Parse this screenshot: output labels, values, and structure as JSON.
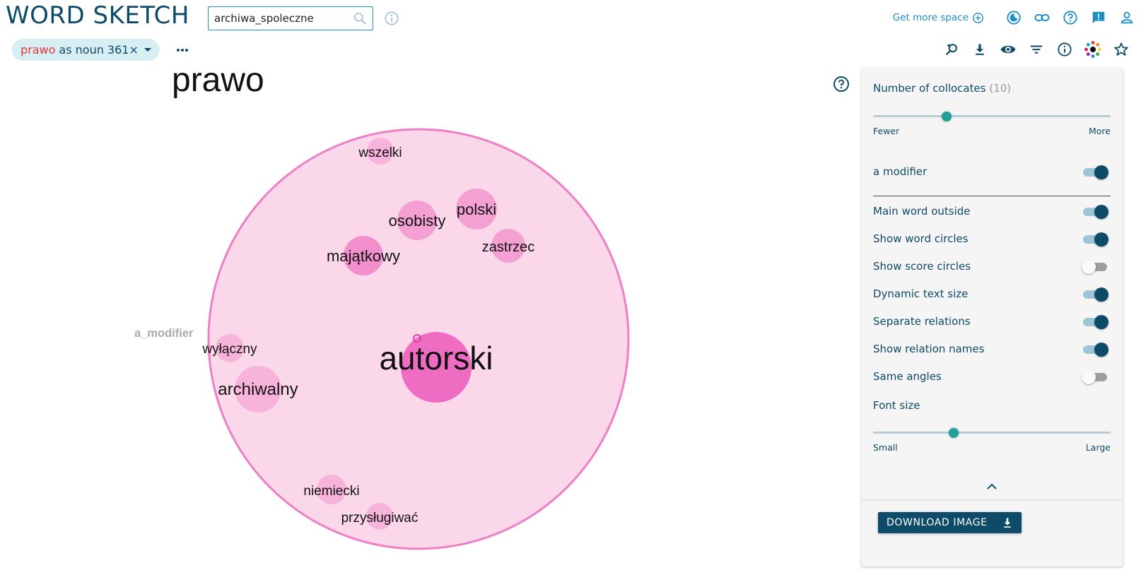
{
  "app": {
    "title": "WORD SKETCH"
  },
  "search": {
    "value": "archiwa_spoleczne"
  },
  "header": {
    "get_more_space": "Get more space"
  },
  "chip": {
    "lemma": "prawo",
    "rest": "as noun 361×"
  },
  "viz": {
    "headword": "prawo",
    "relation_label": "a_modifier",
    "center_word": "autorski",
    "collocates": [
      "wszelki",
      "osobisty",
      "polski",
      "majątkowy",
      "zastrzec",
      "wyłączny",
      "archiwalny",
      "niemiecki",
      "przysługiwać"
    ],
    "colors": {
      "outer_fill": "#fbd7ea",
      "outer_stroke": "#ee7fc6",
      "bubble": "#f5a0d2",
      "center_bubble": "#ef6cc3"
    }
  },
  "panel": {
    "num_collocates_label": "Number of collocates",
    "num_collocates_value": "(10)",
    "fewer": "Fewer",
    "more": "More",
    "collocates_slider_fraction": 0.31,
    "relation_toggle_label": "a  modifier",
    "relation_toggle_on": true,
    "options": [
      {
        "label": "Main word outside",
        "on": true
      },
      {
        "label": "Show word circles",
        "on": true
      },
      {
        "label": "Show score circles",
        "on": false
      },
      {
        "label": "Dynamic text size",
        "on": true
      },
      {
        "label": "Separate relations",
        "on": true
      },
      {
        "label": "Show relation names",
        "on": true
      },
      {
        "label": "Same angles",
        "on": false
      }
    ],
    "font_size_label": "Font size",
    "small": "Small",
    "large": "Large",
    "font_slider_fraction": 0.34,
    "download_label": "DOWNLOAD IMAGE"
  },
  "theme": {
    "accent": "#0d4b68",
    "link": "#1f8ec2",
    "slider": "#21a099",
    "lemma_red": "#e2353a"
  }
}
